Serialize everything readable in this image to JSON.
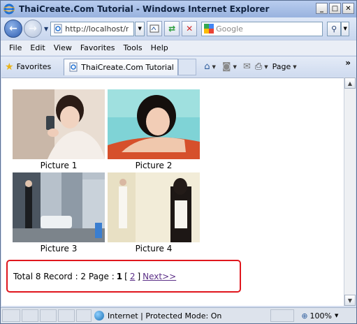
{
  "window": {
    "title": "ThaiCreate.Com Tutorial - Windows Internet Explorer"
  },
  "address": {
    "url": "http://localhost/r",
    "search_placeholder": "Google"
  },
  "menu": [
    "File",
    "Edit",
    "View",
    "Favorites",
    "Tools",
    "Help"
  ],
  "favbar": {
    "favorites_label": "Favorites",
    "tab_label": "ThaiCreate.Com Tutorial",
    "page_label": "Page"
  },
  "gallery": [
    {
      "caption": "Picture 1"
    },
    {
      "caption": "Picture 2"
    },
    {
      "caption": "Picture 3"
    },
    {
      "caption": "Picture 4"
    }
  ],
  "pager": {
    "summary": "Total 8 Record : 2 Page :",
    "current_page": "1",
    "bracket_open": "[",
    "other_page": "2",
    "bracket_close": "]",
    "next_label": "Next>>"
  },
  "status": {
    "zone_text": "Internet | Protected Mode: On",
    "zoom_text": "100%"
  },
  "colors": {
    "highlight_box": "#e0161d",
    "link_visited": "#5b2f87"
  }
}
